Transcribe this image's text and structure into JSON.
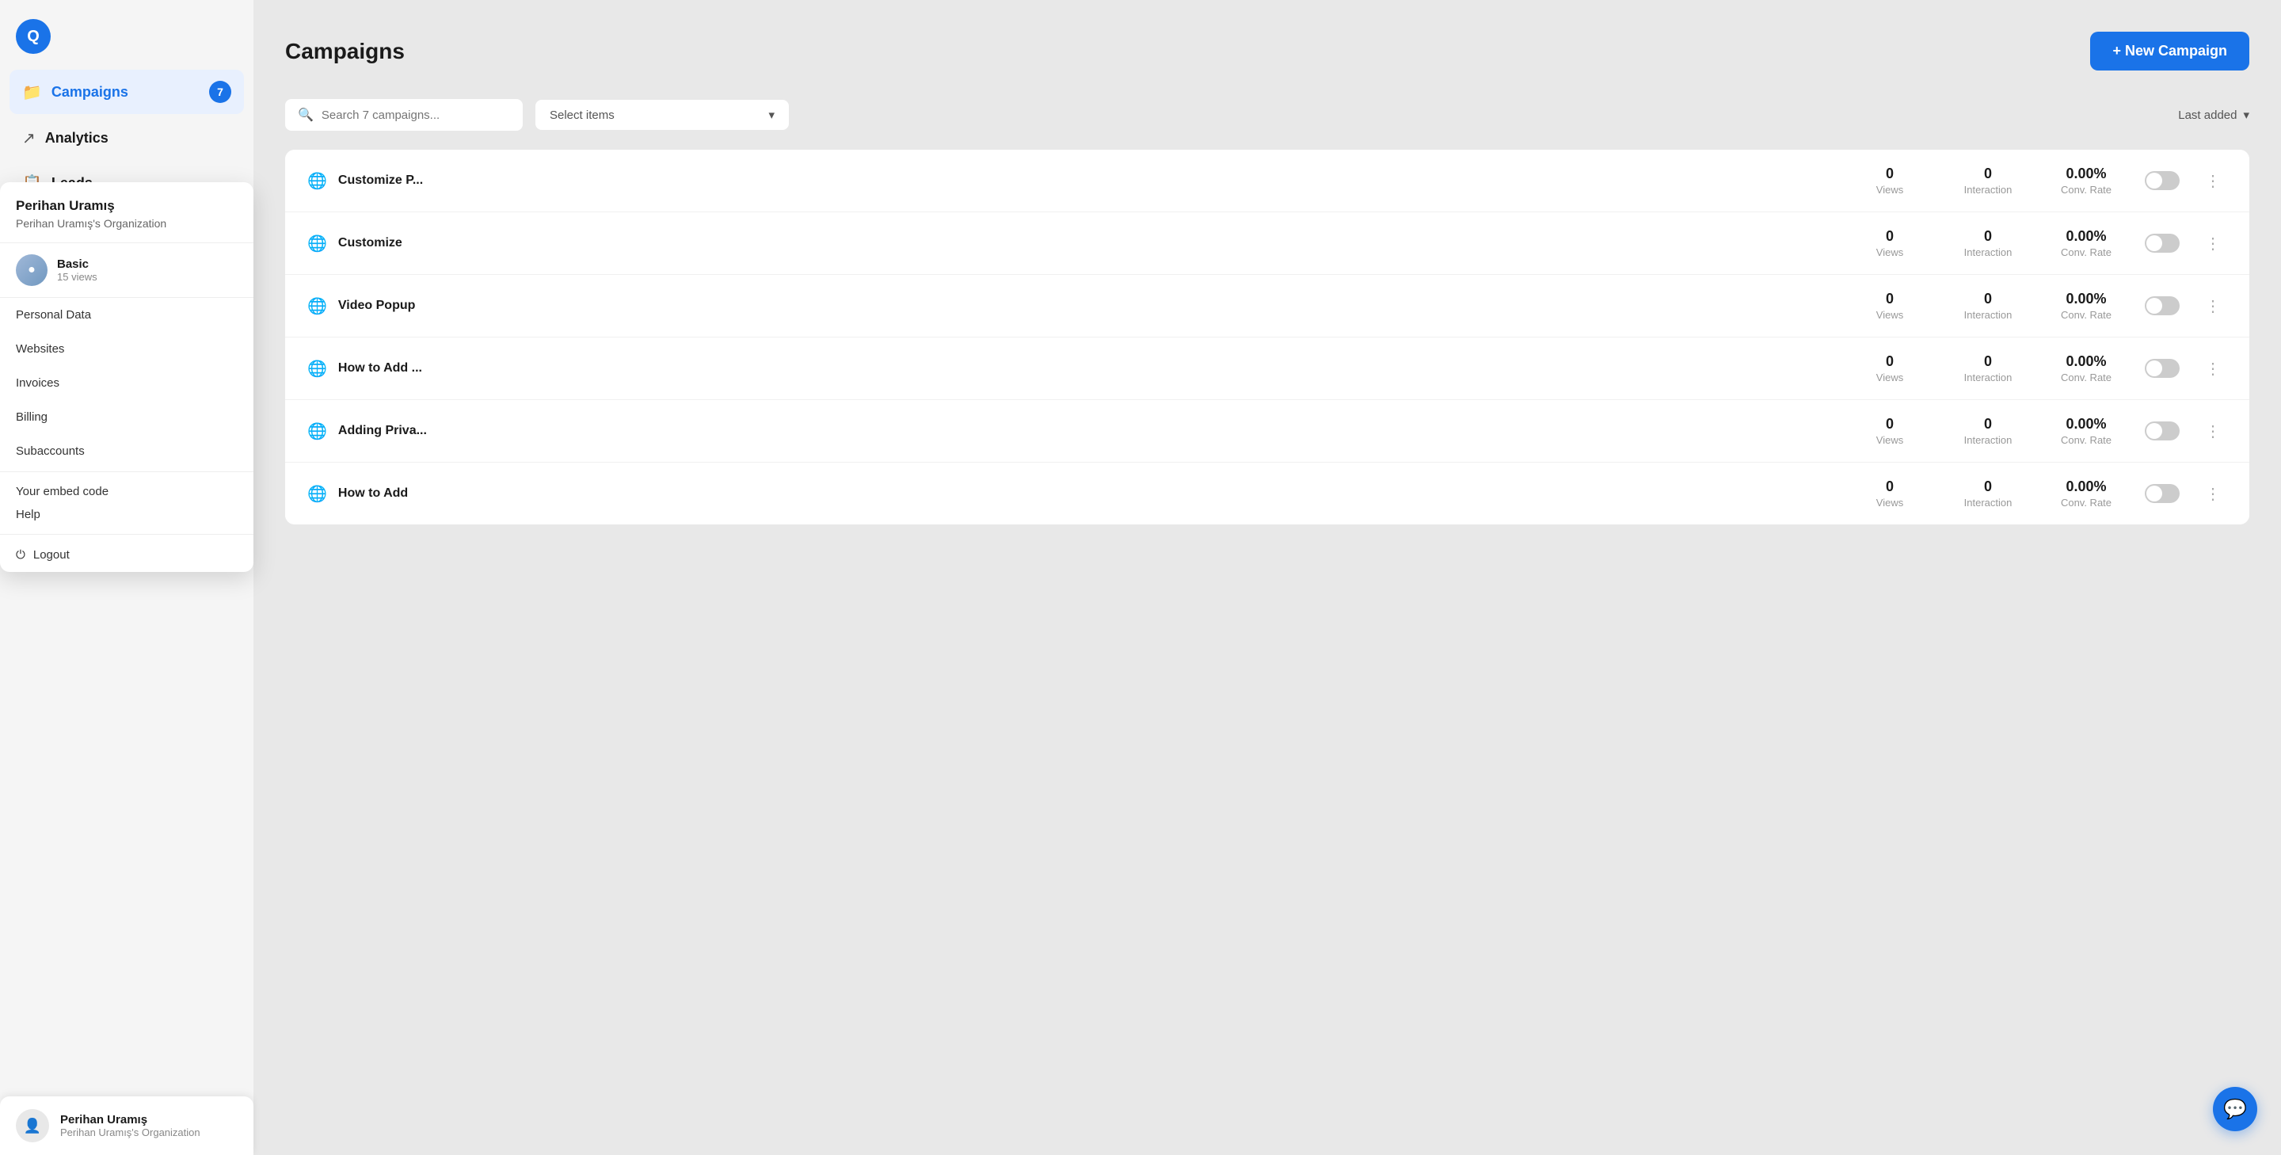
{
  "app": {
    "logo_letter": "Q"
  },
  "sidebar": {
    "nav_items": [
      {
        "id": "campaigns",
        "label": "Campaigns",
        "icon": "📁",
        "active": true,
        "badge": "7"
      },
      {
        "id": "analytics",
        "label": "Analytics",
        "icon": "↗",
        "active": false
      },
      {
        "id": "leads",
        "label": "Leads",
        "icon": "📋",
        "active": false
      }
    ]
  },
  "profile_dropdown": {
    "name": "Perihan Uramış",
    "org": "Perihan Uramış's Organization",
    "plan_name": "Basic",
    "plan_views": "15 views",
    "menu_items": [
      {
        "id": "personal-data",
        "label": "Personal Data"
      },
      {
        "id": "websites",
        "label": "Websites",
        "active": true
      },
      {
        "id": "invoices",
        "label": "Invoices"
      },
      {
        "id": "billing",
        "label": "Billing"
      },
      {
        "id": "subaccounts",
        "label": "Subaccounts"
      }
    ],
    "embed_code_label": "Your embed code",
    "help_label": "Help",
    "logout_label": "Logout"
  },
  "bottom_user": {
    "name": "Perihan Uramış",
    "org": "Perihan Uramış's Organization"
  },
  "main": {
    "title": "Campaigns",
    "new_campaign_label": "+ New Campaign",
    "search_placeholder": "Search 7 campaigns...",
    "select_items_label": "Select items",
    "sort_label": "Last added",
    "campaigns": [
      {
        "id": 1,
        "name": "Customize P...",
        "views": "0",
        "interaction": "0",
        "conv_rate": "0.00%",
        "enabled": false
      },
      {
        "id": 2,
        "name": "Customize",
        "views": "0",
        "interaction": "0",
        "conv_rate": "0.00%",
        "enabled": false
      },
      {
        "id": 3,
        "name": "Video Popup",
        "views": "0",
        "interaction": "0",
        "conv_rate": "0.00%",
        "enabled": false
      },
      {
        "id": 4,
        "name": "How to Add ...",
        "views": "0",
        "interaction": "0",
        "conv_rate": "0.00%",
        "enabled": false
      },
      {
        "id": 5,
        "name": "Adding Priva...",
        "views": "0",
        "interaction": "0",
        "conv_rate": "0.00%",
        "enabled": false
      },
      {
        "id": 6,
        "name": "How to Add",
        "views": "0",
        "interaction": "0",
        "conv_rate": "0.00%",
        "enabled": false
      }
    ],
    "col_labels": {
      "views": "Views",
      "interaction": "Interaction",
      "conv_rate": "Conv. Rate"
    }
  }
}
